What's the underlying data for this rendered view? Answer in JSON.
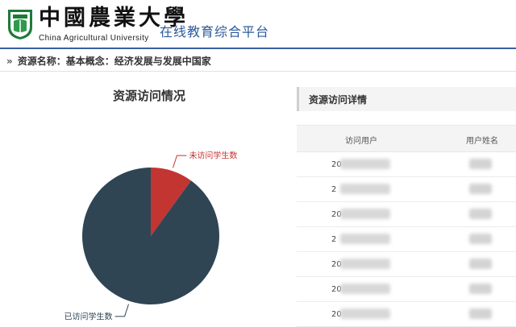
{
  "header": {
    "logo_cn": "中國農業大學",
    "logo_en": "China Agricultural University",
    "platform_title": "在线教育综合平台"
  },
  "breadcrumb": {
    "arrows": "»",
    "text": "资源名称：基本概念：经济发展与发展中国家"
  },
  "chart": {
    "title": "资源访问情况"
  },
  "chart_data": {
    "type": "pie",
    "title": "资源访问情况",
    "slices": [
      {
        "label": "已访问学生数",
        "value": 90,
        "color": "#2f4554"
      },
      {
        "label": "未访问学生数",
        "value": 10,
        "color": "#c23531"
      }
    ]
  },
  "panel": {
    "title": "资源访问详情",
    "columns": [
      "访问用户",
      "用户姓名"
    ],
    "rows": [
      "20",
      "2",
      "20",
      "2",
      "20",
      "20",
      "20"
    ]
  }
}
